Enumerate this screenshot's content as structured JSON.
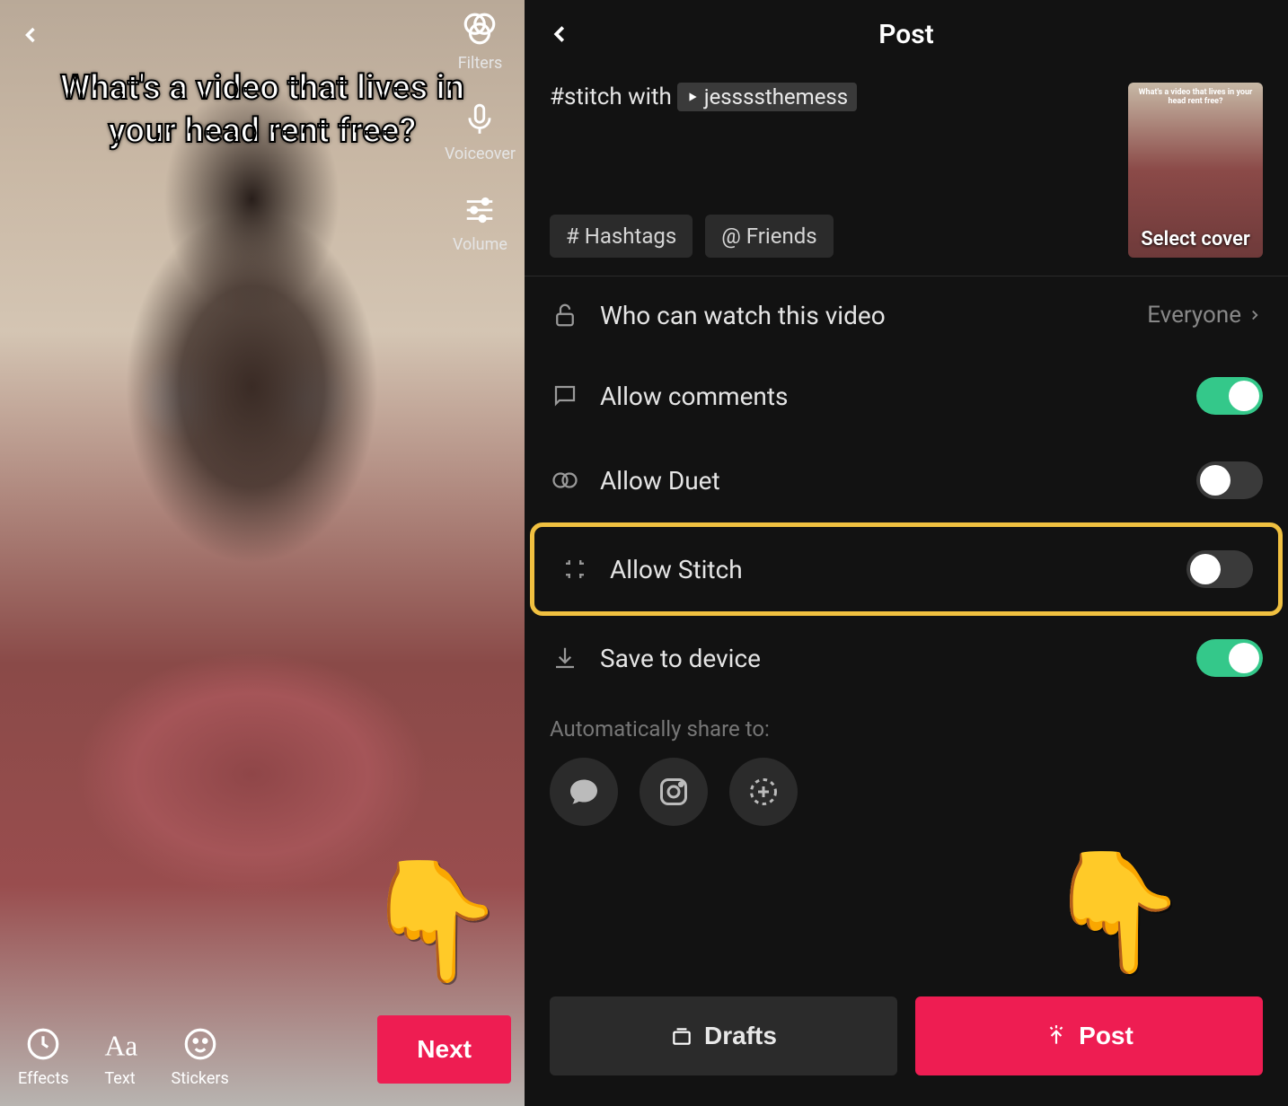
{
  "left": {
    "caption": "What's a video that lives in your head rent free?",
    "tools": {
      "filters": "Filters",
      "voiceover": "Voiceover",
      "volume": "Volume"
    },
    "bottom_tools": {
      "effects": "Effects",
      "text": "Text",
      "stickers": "Stickers"
    },
    "next": "Next"
  },
  "right": {
    "title": "Post",
    "caption_prefix": "#stitch with",
    "username": "jessssthemess",
    "hashtags_btn": "# Hashtags",
    "friends_btn": "@ Friends",
    "select_cover": "Select cover",
    "settings": {
      "privacy_label": "Who can watch this video",
      "privacy_value": "Everyone",
      "comments": "Allow comments",
      "duet": "Allow Duet",
      "stitch": "Allow Stitch",
      "save": "Save to device"
    },
    "toggles": {
      "comments": true,
      "duet": false,
      "stitch": false,
      "save": true
    },
    "share_label": "Automatically share to:",
    "drafts": "Drafts",
    "post": "Post"
  }
}
